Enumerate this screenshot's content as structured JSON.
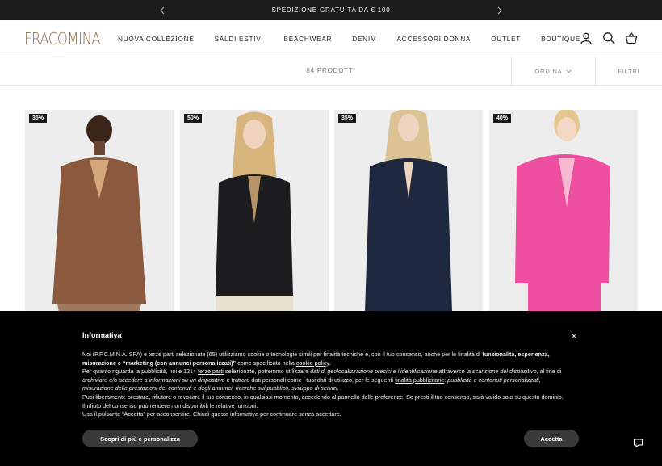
{
  "announcement": {
    "text": "SPEDIZIONE GRATUITA DA € 100"
  },
  "header": {
    "logo": "FRACOMINA",
    "nav": [
      "NUOVA COLLEZIONE",
      "SALDI ESTIVI",
      "BEACHWEAR",
      "DENIM",
      "ACCESSORI DONNA",
      "OUTLET",
      "BOUTIQUE"
    ],
    "icons": [
      "account-icon",
      "search-icon",
      "cart-icon"
    ]
  },
  "toolbar": {
    "count": "84 PRODOTTI",
    "sort": "ORDINA",
    "filters": "FILTRI"
  },
  "products": [
    {
      "badge": "35%",
      "color": "#8b5a3e"
    },
    {
      "badge": "50%",
      "color": "#1d1d1f"
    },
    {
      "badge": "35%",
      "color": "#1e2940"
    },
    {
      "badge": "40%",
      "color": "#ee4fa0"
    }
  ],
  "cookie": {
    "title": "Informativa",
    "close": "×",
    "p1_a": "Noi (P.F.C.M.N.A. SPA) e terze parti selezionate (65) utilizziamo cookie o tecnologie simili per finalità tecniche e, con il tuo consenso, anche per le finalità di ",
    "p1_b": "funzionalità, esperienza, misurazione e “marketing (con annunci personalizzati)”",
    "p1_c": " come specificato nella ",
    "p1_link": "cookie policy",
    "p1_d": ".",
    "p2_a": "Per quanto riguarda la pubblicità, noi e 1214 ",
    "p2_link1": "terze parti",
    "p2_b": " selezionate, potremmo utilizzare ",
    "p2_i1": "dati di geolocalizzazione precisi e l’identificazione attraverso la scansione del dispositivo",
    "p2_c": ", al fine di ",
    "p2_i2": "archiviare e/o accedere a informazioni su un dispositivo",
    "p2_d": " e trattare dati personali come i tuoi dati di utilizzo, per le seguenti ",
    "p2_link2": "finalità pubblicitarie",
    "p2_e": ": ",
    "p2_i3": "pubblicità e contenuti personalizzati, misurazione delle prestazioni dei contenuti e degli annunci, ricerche sul pubblico, sviluppo di servizi",
    "p2_f": ".",
    "p3": "Puoi liberamente prestare, rifiutare o revocare il tuo consenso, in qualsiasi momento, accedendo al pannello delle preferenze. Se presti il tuo consenso, sarà valido solo su questo dominio. Il rifiuto del consenso può rendere non disponibili le relative funzioni.",
    "p4": "Usa il pulsante “Accetta” per acconsentire. Chiudi questa informativa per continuare senza accettare.",
    "btn_more": "Scopri di più e personalizza",
    "btn_accept": "Accetta"
  }
}
